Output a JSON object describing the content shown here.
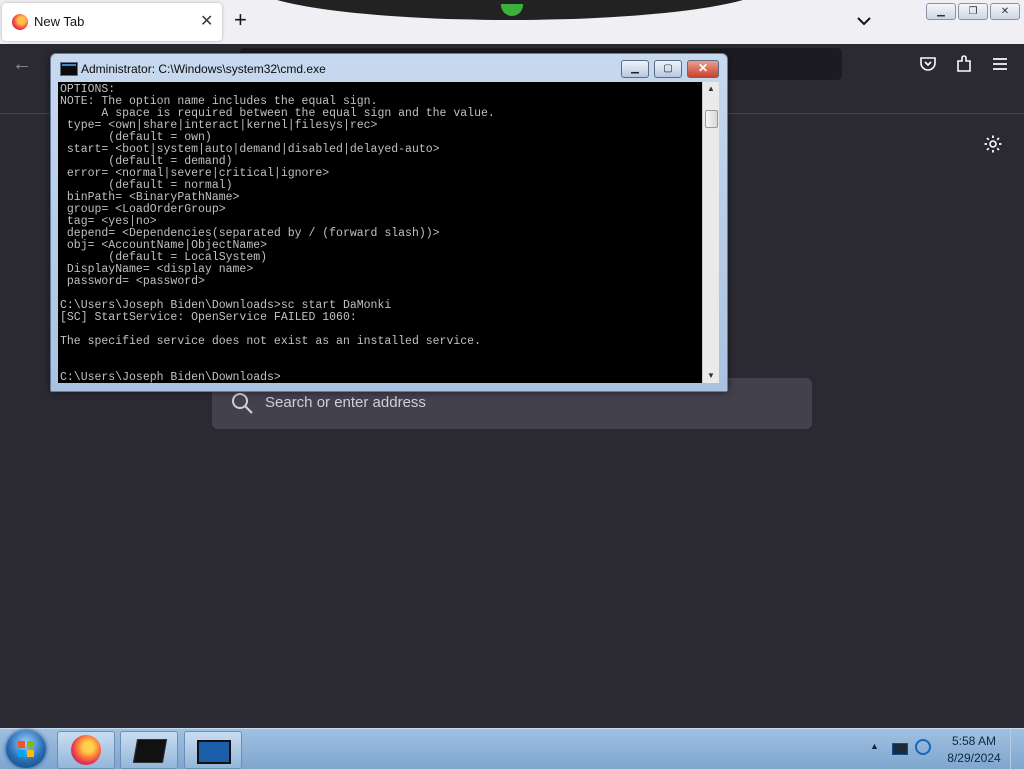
{
  "browser": {
    "tab_title": "New Tab",
    "tab_close": "✕",
    "new_tab": "+",
    "search_placeholder": "Search or enter address"
  },
  "cmd": {
    "title": "Administrator: C:\\Windows\\system32\\cmd.exe",
    "lines": [
      "OPTIONS:",
      "NOTE: The option name includes the equal sign.",
      "      A space is required between the equal sign and the value.",
      " type= <own|share|interact|kernel|filesys|rec>",
      "       (default = own)",
      " start= <boot|system|auto|demand|disabled|delayed-auto>",
      "       (default = demand)",
      " error= <normal|severe|critical|ignore>",
      "       (default = normal)",
      " binPath= <BinaryPathName>",
      " group= <LoadOrderGroup>",
      " tag= <yes|no>",
      " depend= <Dependencies(separated by / (forward slash))>",
      " obj= <AccountName|ObjectName>",
      "       (default = LocalSystem)",
      " DisplayName= <display name>",
      " password= <password>",
      "",
      "C:\\Users\\Joseph Biden\\Downloads>sc start DaMonki",
      "[SC] StartService: OpenService FAILED 1060:",
      "",
      "The specified service does not exist as an installed service.",
      "",
      "",
      "C:\\Users\\Joseph Biden\\Downloads>"
    ]
  },
  "taskbar": {
    "time": "5:58 AM",
    "date": "8/29/2024"
  },
  "icons": {
    "firefox": "firefox-icon",
    "terminal": "terminal-icon",
    "cmd": "cmd-icon",
    "settings": "gear-icon",
    "search": "search-icon"
  }
}
